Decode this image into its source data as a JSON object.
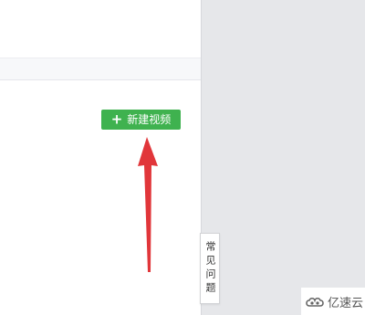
{
  "toolbar": {
    "new_video_label": "新建视频",
    "new_video_icon": "plus-icon"
  },
  "annotation": {
    "arrow_color": "#e1363a"
  },
  "side_panel": {
    "faq_label": "常见问题"
  },
  "watermark": {
    "text": "亿速云"
  },
  "colors": {
    "accent_green": "#3fb24f",
    "panel_gray": "#e6e7ea"
  }
}
